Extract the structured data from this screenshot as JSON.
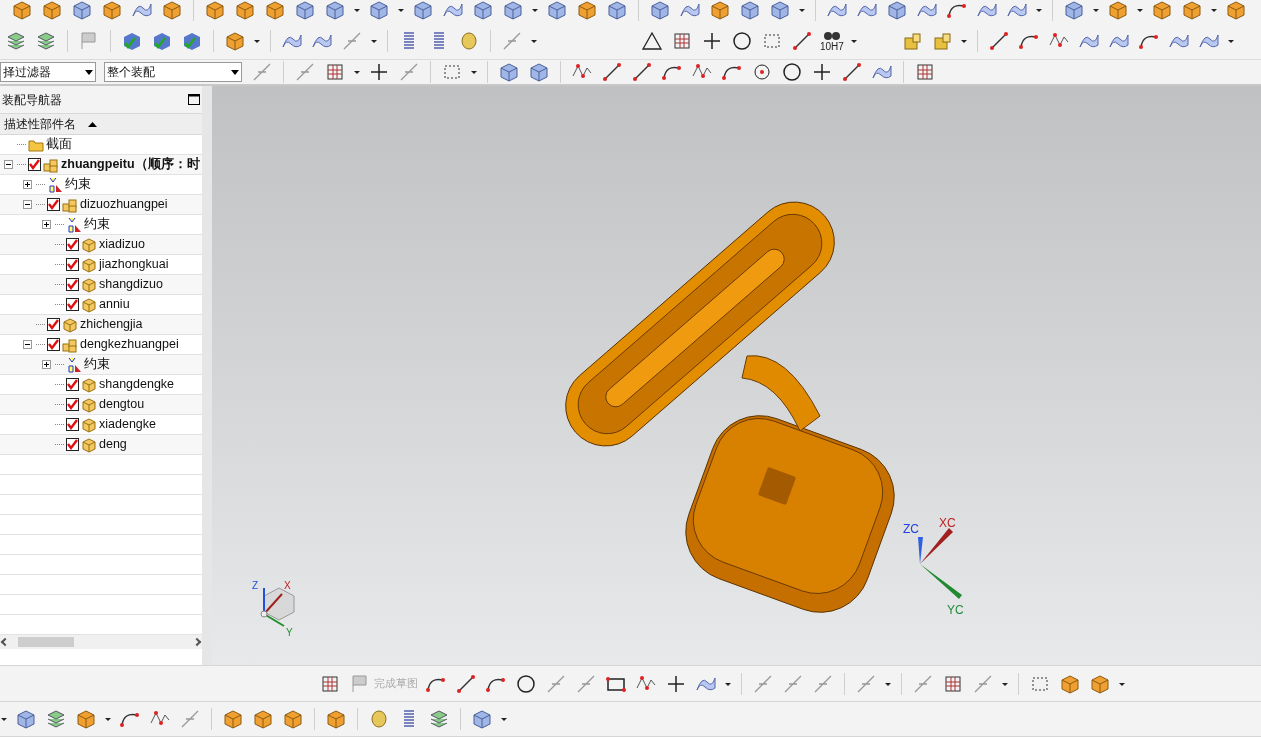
{
  "toolbar": {
    "dimension_label": "10H7"
  },
  "filter_bar": {
    "fields": [
      {
        "value": "择过滤器"
      },
      {
        "value": "整个装配"
      }
    ]
  },
  "navigator": {
    "title": "装配导航器",
    "column_header": "描述性部件名",
    "tree": [
      {
        "label": "截面",
        "kind": "folder"
      },
      {
        "label": "zhuangpeitu（顺序：时",
        "kind": "assembly",
        "bold": true,
        "checked": true,
        "expanded": true,
        "children": [
          {
            "label": "约束",
            "kind": "constraints",
            "expanded": false
          },
          {
            "label": "dizuozhuangpei",
            "kind": "assembly",
            "checked": true,
            "expanded": true,
            "children": [
              {
                "label": "约束",
                "kind": "constraints",
                "expanded": false
              },
              {
                "label": "xiadizuo",
                "kind": "part",
                "checked": true
              },
              {
                "label": "jiazhongkuai",
                "kind": "part",
                "checked": true
              },
              {
                "label": "shangdizuo",
                "kind": "part",
                "checked": true
              },
              {
                "label": "anniu",
                "kind": "part",
                "checked": true
              }
            ]
          },
          {
            "label": "zhichengjia",
            "kind": "part",
            "checked": true
          },
          {
            "label": "dengkezhuangpei",
            "kind": "assembly",
            "checked": true,
            "expanded": true,
            "children": [
              {
                "label": "约束",
                "kind": "constraints",
                "expanded": false
              },
              {
                "label": "shangdengke",
                "kind": "part",
                "checked": true
              },
              {
                "label": "dengtou",
                "kind": "part",
                "checked": true
              },
              {
                "label": "xiadengke",
                "kind": "part",
                "checked": true
              },
              {
                "label": "deng",
                "kind": "part",
                "checked": true
              }
            ]
          }
        ]
      }
    ]
  },
  "viewport": {
    "triad_labels": [
      "ZC",
      "XC",
      "YC"
    ],
    "mini_triad_labels": [
      "Z",
      "X",
      "Y"
    ]
  },
  "sketch_toolbar": {
    "finish_button": {
      "label": "完成草图",
      "disabled": true
    }
  }
}
